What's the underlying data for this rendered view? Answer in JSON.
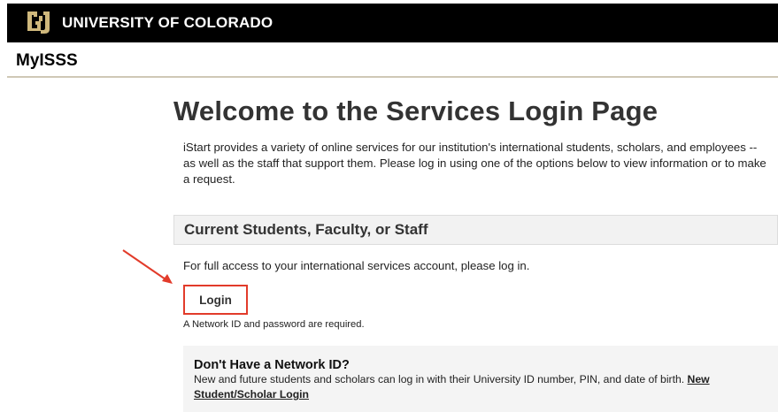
{
  "header": {
    "university_name": "UNIVERSITY OF COLORADO",
    "logo_icon": "cu-buffalo-logo-icon",
    "brand_gold": "#CFB87C",
    "bar_color": "#000000"
  },
  "app": {
    "name": "MyISSS"
  },
  "main": {
    "title": "Welcome to the Services Login Page",
    "intro": "iStart provides a variety of online services for our institution's international students, scholars, and employees -- as well as the staff that support them. Please log in using one of the options below to view information or to make a request.",
    "section": {
      "heading": "Current Students, Faculty, or Staff",
      "access_text": "For full access to your international services account, please log in.",
      "login_label": "Login",
      "required_note": "A Network ID and password are required.",
      "highlight_color": "#E23B2A"
    },
    "network_box": {
      "heading": "Don't Have a Network ID?",
      "text": "New and future students and scholars can log in with their University ID number, PIN, and date of birth.",
      "link_line1": "New",
      "link_line2": "Student/Scholar Login"
    }
  },
  "annotation": {
    "arrow_icon": "red-arrow-icon",
    "color": "#E23B2A"
  }
}
